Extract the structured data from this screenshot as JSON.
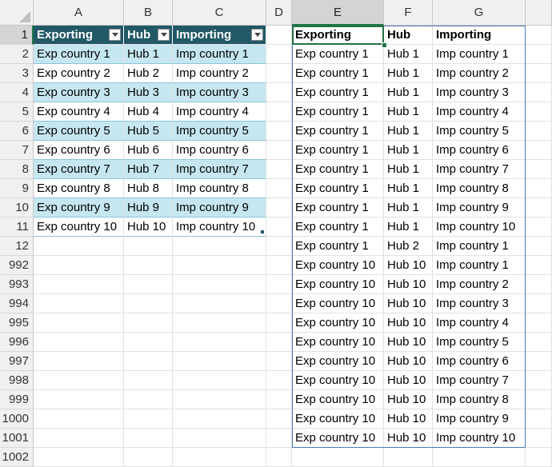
{
  "columns": [
    "A",
    "B",
    "C",
    "D",
    "E",
    "F",
    "G"
  ],
  "selected_column": "E",
  "rows": [
    "1",
    "2",
    "3",
    "4",
    "5",
    "6",
    "7",
    "8",
    "9",
    "10",
    "11",
    "12",
    "992",
    "993",
    "994",
    "995",
    "996",
    "997",
    "998",
    "999",
    "1000",
    "1001",
    "1002"
  ],
  "selected_row": "1",
  "table": {
    "headers": [
      "Exporting",
      "Hub",
      "Importing"
    ],
    "rows": [
      [
        "Exp country 1",
        "Hub 1",
        "Imp country 1"
      ],
      [
        "Exp country 2",
        "Hub 2",
        "Imp country 2"
      ],
      [
        "Exp country 3",
        "Hub 3",
        "Imp country 3"
      ],
      [
        "Exp country 4",
        "Hub 4",
        "Imp country 4"
      ],
      [
        "Exp country 5",
        "Hub 5",
        "Imp country 5"
      ],
      [
        "Exp country 6",
        "Hub 6",
        "Imp country 6"
      ],
      [
        "Exp country 7",
        "Hub 7",
        "Imp country 7"
      ],
      [
        "Exp country 8",
        "Hub 8",
        "Imp country 8"
      ],
      [
        "Exp country 9",
        "Hub 9",
        "Imp country 9"
      ],
      [
        "Exp country 10",
        "Hub 10",
        "Imp country 10"
      ]
    ]
  },
  "result": {
    "headers": [
      "Exporting",
      "Hub",
      "Importing"
    ],
    "rows": [
      [
        "Exp country 1",
        "Hub 1",
        "Imp country 1"
      ],
      [
        "Exp country 1",
        "Hub 1",
        "Imp country 2"
      ],
      [
        "Exp country 1",
        "Hub 1",
        "Imp country 3"
      ],
      [
        "Exp country 1",
        "Hub 1",
        "Imp country 4"
      ],
      [
        "Exp country 1",
        "Hub 1",
        "Imp country 5"
      ],
      [
        "Exp country 1",
        "Hub 1",
        "Imp country 6"
      ],
      [
        "Exp country 1",
        "Hub 1",
        "Imp country 7"
      ],
      [
        "Exp country 1",
        "Hub 1",
        "Imp country 8"
      ],
      [
        "Exp country 1",
        "Hub 1",
        "Imp country 9"
      ],
      [
        "Exp country 1",
        "Hub 1",
        "Imp country 10"
      ],
      [
        "Exp country 1",
        "Hub 2",
        "Imp country 1"
      ],
      [
        "Exp country 10",
        "Hub 10",
        "Imp country 1"
      ],
      [
        "Exp country 10",
        "Hub 10",
        "Imp country 2"
      ],
      [
        "Exp country 10",
        "Hub 10",
        "Imp country 3"
      ],
      [
        "Exp country 10",
        "Hub 10",
        "Imp country 4"
      ],
      [
        "Exp country 10",
        "Hub 10",
        "Imp country 5"
      ],
      [
        "Exp country 10",
        "Hub 10",
        "Imp country 6"
      ],
      [
        "Exp country 10",
        "Hub 10",
        "Imp country 7"
      ],
      [
        "Exp country 10",
        "Hub 10",
        "Imp country 8"
      ],
      [
        "Exp country 10",
        "Hub 10",
        "Imp country 9"
      ],
      [
        "Exp country 10",
        "Hub 10",
        "Imp country 10"
      ]
    ]
  },
  "colors": {
    "table_header": "#215967",
    "table_band": "#c6e7f1",
    "selection": "#217346",
    "result_border": "#4a7ab5"
  },
  "icons": {
    "filter": "filter-dropdown-icon",
    "select_all": "select-all-triangle-icon"
  }
}
